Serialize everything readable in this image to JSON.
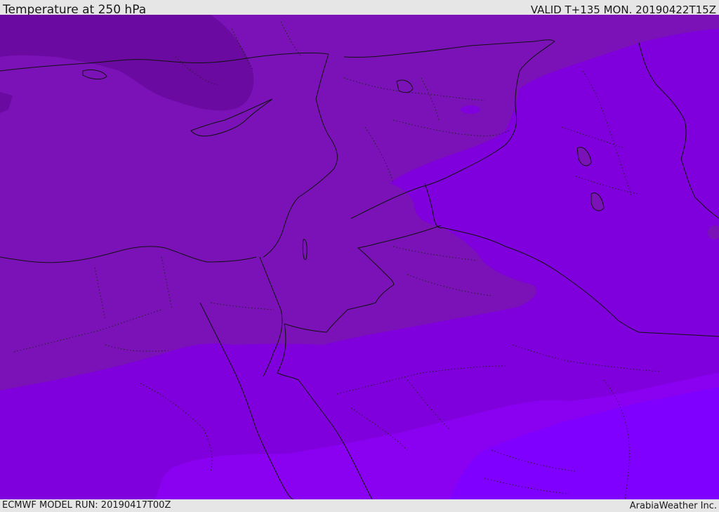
{
  "header": {
    "title": "Temperature at 250 hPa",
    "valid_time": "VALID T+135 MON. 20190422T15Z"
  },
  "footer": {
    "model_run": "ECMWF MODEL RUN: 20190417T00Z",
    "credit": "ArabiaWeather Inc."
  },
  "map": {
    "region": "Eastern Mediterranean, Levant, Arabia",
    "palette": {
      "coldest": "#6a0aa0",
      "cold": "#7a12b8",
      "mid": "#7f00dc",
      "warm": "#8a00f0",
      "warmest": "#8000ff",
      "border": "#111111"
    }
  }
}
